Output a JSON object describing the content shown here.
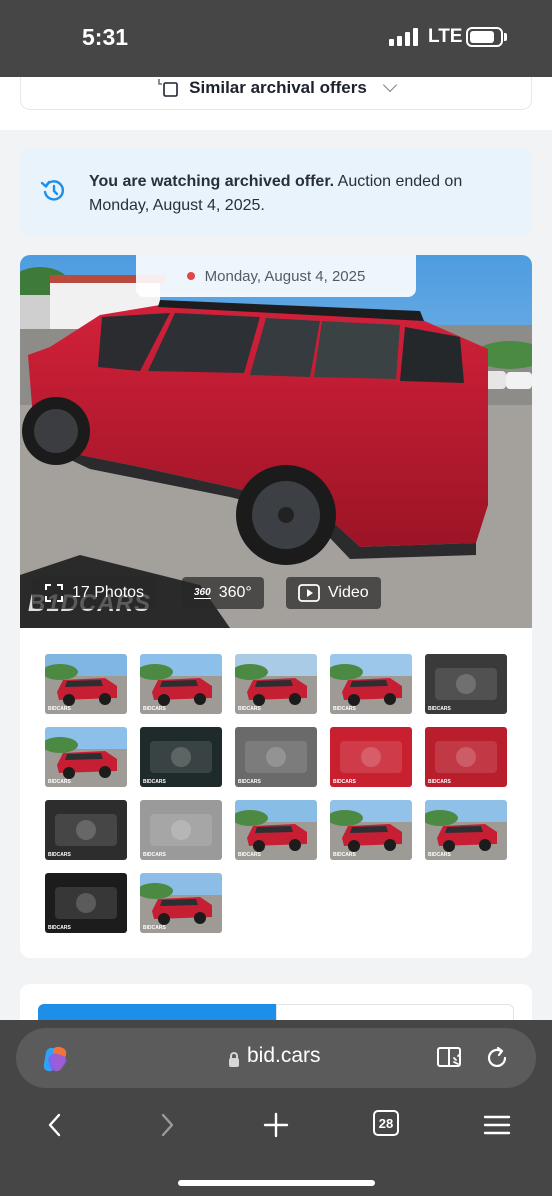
{
  "status_bar": {
    "time": "5:31",
    "network": "LTE"
  },
  "similar": {
    "label": "Similar archival offers"
  },
  "notice": {
    "bold": "You are watching archived offer.",
    "text": " Auction ended on Monday, August 4, 2025."
  },
  "photo": {
    "date": "Monday, August 4, 2025",
    "photos_label": "17 Photos",
    "three60_badge": "360",
    "three60_label": "360°",
    "video_label": "Video",
    "watermark": "BIDCARS"
  },
  "thumbnails": [
    {
      "kind": "car-front-left",
      "sky": "#7fb6e2"
    },
    {
      "kind": "car-front-right",
      "sky": "#8cc0ea"
    },
    {
      "kind": "car-side",
      "sky": "#a9cbe6"
    },
    {
      "kind": "car-rear",
      "sky": "#9cc6ea"
    },
    {
      "kind": "interior-seats",
      "sky": "#3a3a3a"
    },
    {
      "kind": "car-front",
      "sky": "#8cc0ea"
    },
    {
      "kind": "dashboard",
      "sky": "#1f2a2a"
    },
    {
      "kind": "interior-rear",
      "sky": "#6a6a6a"
    },
    {
      "kind": "label-sticker",
      "sky": "#c92030"
    },
    {
      "kind": "engine-bay",
      "sky": "#b91e2c"
    },
    {
      "kind": "keys",
      "sky": "#2d2d2d"
    },
    {
      "kind": "wheel-parts",
      "sky": "#9a9a9a"
    },
    {
      "kind": "car-front",
      "sky": "#88bde6"
    },
    {
      "kind": "car-side-right",
      "sky": "#92c2ea"
    },
    {
      "kind": "car-side-left",
      "sky": "#8ec0e8"
    },
    {
      "kind": "odometer",
      "sky": "#1c1c1c"
    },
    {
      "kind": "car-rear-view",
      "sky": "#8cbde6"
    }
  ],
  "browser": {
    "url": "bid.cars",
    "tab_count": "28"
  },
  "colors": {
    "accent": "#1e8fe8",
    "status_bg": "#464646",
    "notice_bg": "#e8f3fc"
  }
}
